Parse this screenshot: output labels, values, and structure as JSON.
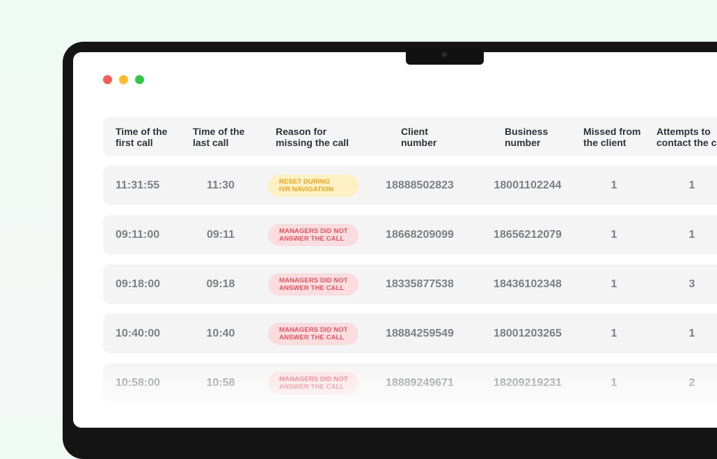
{
  "window": {
    "controls": [
      "close",
      "minimize",
      "maximize"
    ]
  },
  "table": {
    "columns": [
      "Time of the\nfirst call",
      "Time of the\nlast call",
      "Reason for\nmissing the call",
      "Client\nnumber",
      "Business\nnumber",
      "Missed from\nthe client",
      "Attempts to\ncontact the client"
    ],
    "rows": [
      {
        "first_call": "11:31:55",
        "last_call": "11:30",
        "reason": "RESET DURING\nIVR NAVIGATION",
        "reason_type": "yellow",
        "client_number": "18888502823",
        "business_number": "18001102244",
        "missed": "1",
        "attempts": "1"
      },
      {
        "first_call": "09:11:00",
        "last_call": "09:11",
        "reason": "MANAGERS DID NOT\nANSWER THE CALL",
        "reason_type": "red",
        "client_number": "18668209099",
        "business_number": "18656212079",
        "missed": "1",
        "attempts": "1"
      },
      {
        "first_call": "09:18:00",
        "last_call": "09:18",
        "reason": "MANAGERS DID NOT\nANSWER THE CALL",
        "reason_type": "red",
        "client_number": "18335877538",
        "business_number": "18436102348",
        "missed": "1",
        "attempts": "3"
      },
      {
        "first_call": "10:40:00",
        "last_call": "10:40",
        "reason": "MANAGERS DID NOT\nANSWER THE CALL",
        "reason_type": "red",
        "client_number": "18884259549",
        "business_number": "18001203265",
        "missed": "1",
        "attempts": "1"
      },
      {
        "first_call": "10:58:00",
        "last_call": "10:58",
        "reason": "MANAGERS DID NOT\nANSWER THE CALL",
        "reason_type": "red",
        "client_number": "18889249671",
        "business_number": "18209219231",
        "missed": "1",
        "attempts": "2"
      }
    ]
  },
  "colors": {
    "badge_yellow_bg": "#fdf1c4",
    "badge_yellow_text": "#e5a21c",
    "badge_red_bg": "#fbdde0",
    "badge_red_text": "#e0525e"
  }
}
